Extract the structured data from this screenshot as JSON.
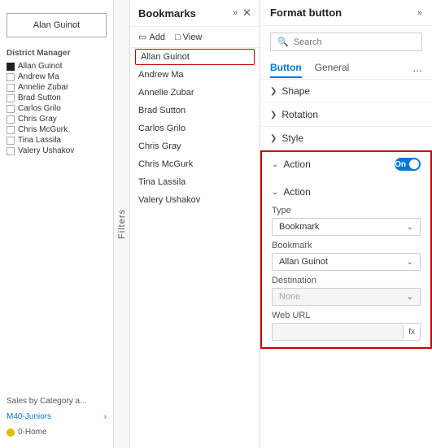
{
  "leftPanel": {
    "personCard": {
      "name": "Alan Guinot"
    },
    "districtLabel": "District Manager",
    "districtList": [
      {
        "name": "Allan Guinot",
        "type": "bullet"
      },
      {
        "name": "Andrew Ma",
        "type": "checkbox"
      },
      {
        "name": "Annelie Zubar",
        "type": "checkbox"
      },
      {
        "name": "Brad Sutton",
        "type": "checkbox"
      },
      {
        "name": "Carlos Grilo",
        "type": "checkbox"
      },
      {
        "name": "Chris Gray",
        "type": "checkbox"
      },
      {
        "name": "Chris McGurk",
        "type": "checkbox"
      },
      {
        "name": "Tina Lassila",
        "type": "checkbox"
      },
      {
        "name": "Valery Ushakov",
        "type": "checkbox"
      }
    ],
    "salesLabel": "Sales by Category a...",
    "m40Label": "M40-Juniors",
    "homeLabel": "0-Home"
  },
  "filtersPanel": {
    "label": "Filters"
  },
  "bookmarksPanel": {
    "title": "Bookmarks",
    "addLabel": "Add",
    "viewLabel": "View",
    "bookmarks": [
      {
        "name": "Allan Guinot",
        "selected": true
      },
      {
        "name": "Andrew Ma"
      },
      {
        "name": "Annelie Zubar"
      },
      {
        "name": "Brad Sutton"
      },
      {
        "name": "Carlos Grilo"
      },
      {
        "name": "Chris Gray"
      },
      {
        "name": "Chris McGurk"
      },
      {
        "name": "Tina Lassila"
      },
      {
        "name": "Valery Ushakov"
      }
    ]
  },
  "formatPanel": {
    "title": "Format button",
    "search": {
      "placeholder": "Search"
    },
    "tabs": [
      "Button",
      "General",
      "..."
    ],
    "activeTab": "Button",
    "sections": [
      {
        "label": "Shape",
        "expanded": false
      },
      {
        "label": "Rotation",
        "expanded": false
      },
      {
        "label": "Style",
        "expanded": false
      }
    ],
    "actionSection": {
      "label": "Action",
      "toggleLabel": "On",
      "subAction": {
        "label": "Action"
      },
      "typeField": {
        "label": "Type",
        "value": "Bookmark"
      },
      "bookmarkField": {
        "label": "Bookmark",
        "value": "Allan Guinot"
      },
      "destinationField": {
        "label": "Destination",
        "value": "None"
      },
      "webUrlField": {
        "label": "Web URL",
        "value": ""
      },
      "fxLabel": "fx"
    }
  }
}
